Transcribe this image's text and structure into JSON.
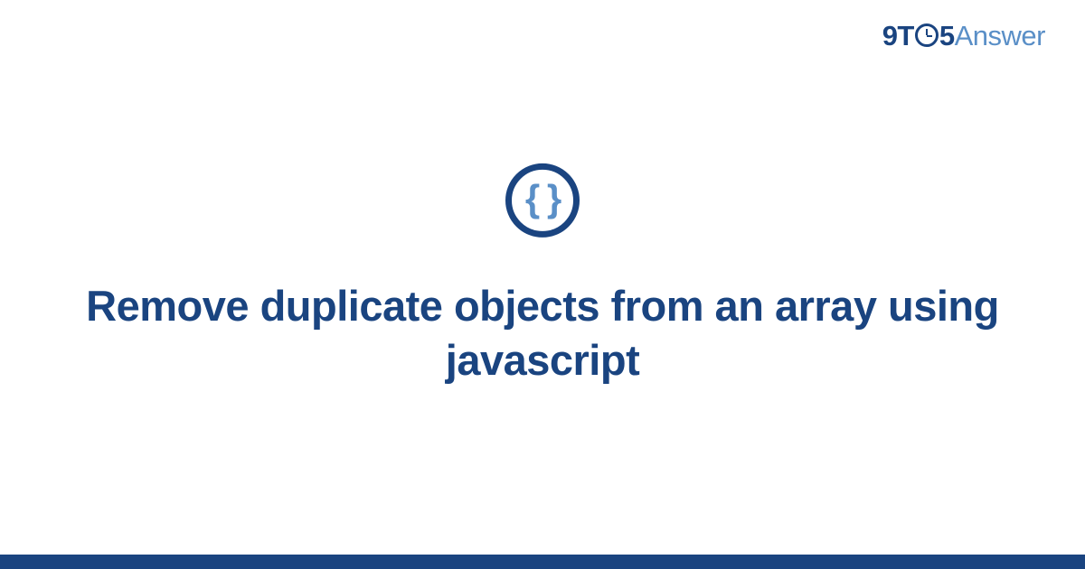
{
  "logo": {
    "prefix": "9T",
    "suffix": "5",
    "word": "Answer"
  },
  "icon": {
    "symbol": "{ }",
    "name": "code-braces"
  },
  "title": "Remove duplicate objects from an array using javascript",
  "colors": {
    "primary": "#1a4480",
    "accent": "#5a8fc7",
    "background": "#ffffff"
  }
}
